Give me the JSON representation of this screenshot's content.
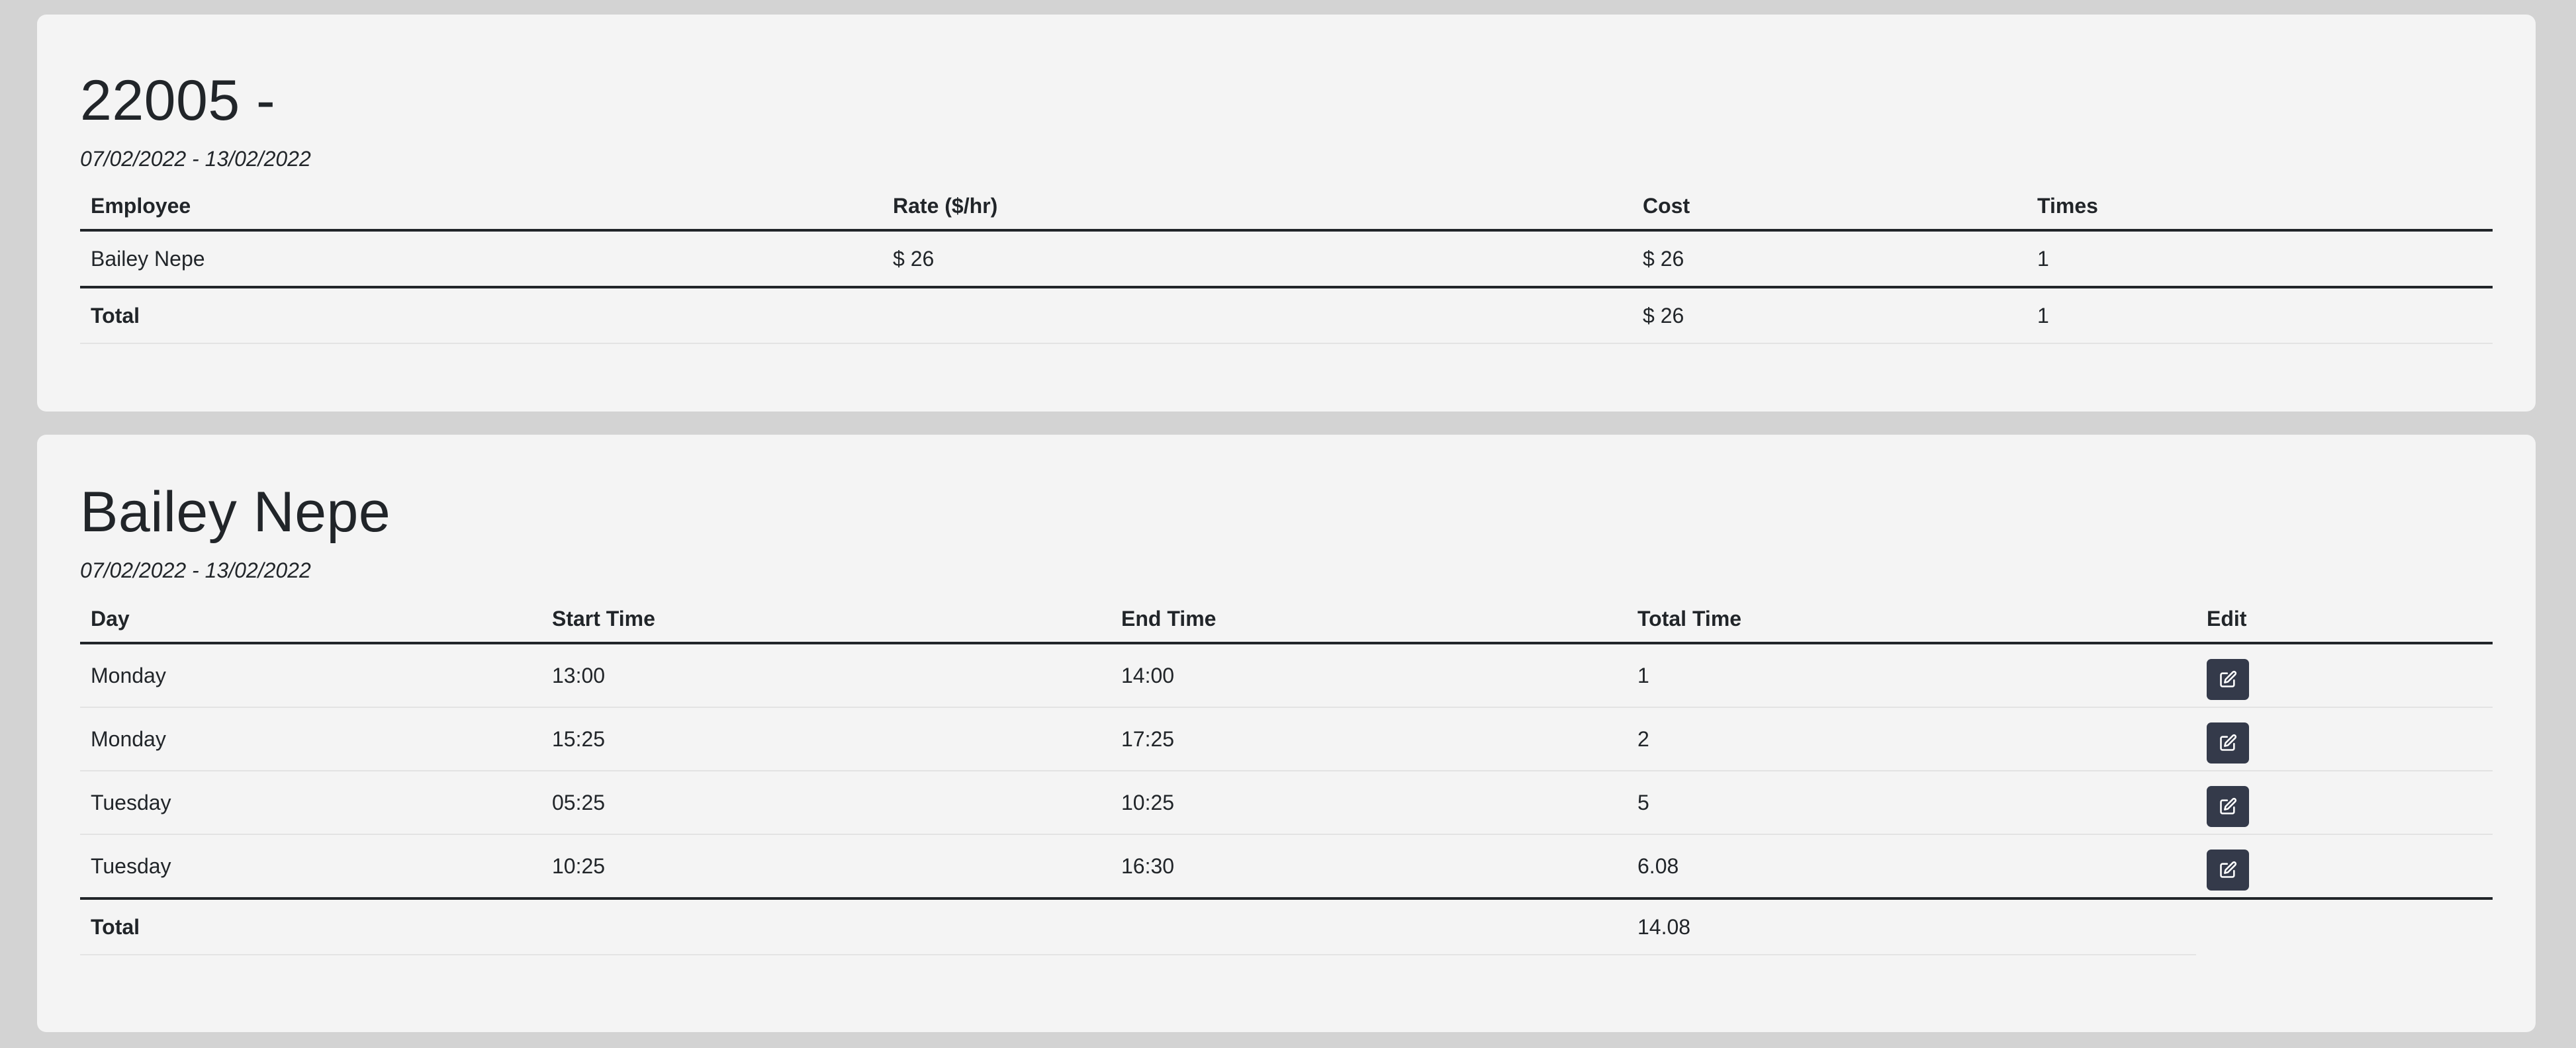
{
  "project": {
    "title": "22005 -",
    "date_range": "07/02/2022 - 13/02/2022",
    "columns": [
      "Employee",
      "Rate ($/hr)",
      "Cost",
      "Times"
    ],
    "rows": [
      {
        "employee": "Bailey Nepe",
        "rate": "$ 26",
        "cost": "$ 26",
        "times": "1"
      }
    ],
    "total": {
      "label": "Total",
      "cost": "$ 26",
      "times": "1"
    }
  },
  "employee": {
    "name": "Bailey Nepe",
    "date_range": "07/02/2022 - 13/02/2022",
    "columns": [
      "Day",
      "Start Time",
      "End Time",
      "Total Time",
      "Edit"
    ],
    "rows": [
      {
        "day": "Monday",
        "start": "13:00",
        "end": "14:00",
        "total": "1",
        "edit_icon": "edit-icon"
      },
      {
        "day": "Monday",
        "start": "15:25",
        "end": "17:25",
        "total": "2",
        "edit_icon": "edit-icon"
      },
      {
        "day": "Tuesday",
        "start": "05:25",
        "end": "10:25",
        "total": "5",
        "edit_icon": "edit-icon"
      },
      {
        "day": "Tuesday",
        "start": "10:25",
        "end": "16:30",
        "total": "6.08",
        "edit_icon": "edit-icon"
      }
    ],
    "total": {
      "label": "Total",
      "total_time": "14.08"
    }
  },
  "colors": {
    "page_bg": "#d3d3d3",
    "card_bg": "#f4f4f4",
    "text": "#212529",
    "edit_button_bg": "#343a4a"
  }
}
